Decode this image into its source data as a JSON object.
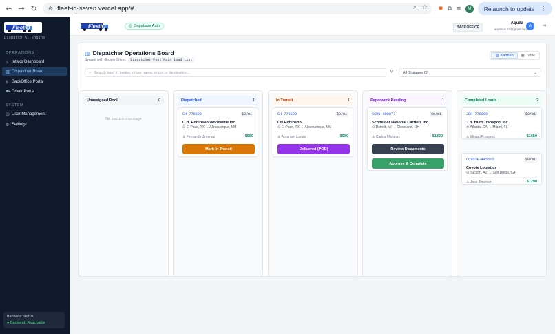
{
  "browser": {
    "url": "fleet-iq-seven.vercel.app/#",
    "relaunch_label": "Relaunch to update",
    "profile_initial": "M"
  },
  "sidebar": {
    "logo_text": "FleetIQ",
    "tagline": "Dispatch AI Engine",
    "operations_label": "OPERATIONS",
    "system_label": "SYSTEM",
    "operations": [
      {
        "label": "Intake Dashboard",
        "icon": "upload-icon"
      },
      {
        "label": "Dispatcher Board",
        "icon": "board-icon"
      },
      {
        "label": "BackOffice Portal",
        "icon": "dollar-icon"
      },
      {
        "label": "Driver Portal",
        "icon": "truck-icon"
      }
    ],
    "system": [
      {
        "label": "User Management",
        "icon": "users-icon"
      },
      {
        "label": "Settings",
        "icon": "gear-icon"
      }
    ],
    "backend_title": "Backend Status",
    "backend_status": "Backend: Reachable"
  },
  "header": {
    "auth_badge": "Supabase Auth",
    "role": "BACKOFFICE",
    "user_name": "Aquila",
    "user_email": "aquila.ai.24@gmail.com",
    "avatar_initial": "A"
  },
  "board": {
    "title": "Dispatcher Operations Board",
    "subtitle_prefix": "Synced with Google Sheet:",
    "sheet_name": "Dispatcher Pool Main Load List",
    "view_kanban": "Kanban",
    "view_table": "Table",
    "search_placeholder": "Search load #, broker, driver name, origin or destination...",
    "status_filter": "All Statuses (5)",
    "columns": [
      {
        "title": "Unassigned Pool",
        "count": "0",
        "empty_text": "No loads in this stage",
        "color": "#f3f4f6",
        "text_color": "#111827"
      },
      {
        "title": "Dispatched",
        "count": "1",
        "color": "#eff6ff",
        "text_color": "#1d4ed8"
      },
      {
        "title": "In Transit",
        "count": "1",
        "color": "#fff7ed",
        "text_color": "#c2410c"
      },
      {
        "title": "Paperwork Pending",
        "count": "1",
        "color": "#faf5ff",
        "text_color": "#7e22ce"
      },
      {
        "title": "Completed Loads",
        "count": "2",
        "color": "#ecfdf5",
        "text_color": "#047857"
      }
    ],
    "cards": [
      {
        "id": "CH-778899",
        "rate": "$0/mi",
        "broker": "C.H. Robinson Worldwide Inc",
        "route": "El Paso, TX → Albuquerque, NM",
        "driver": "Fernando Jimenez",
        "pay": "$980",
        "button": "Mark In Transit"
      },
      {
        "id": "CH-778899",
        "rate": "$0/mi",
        "broker": "CH Robinson",
        "route": "El Paso, TX → Albuquerque, NM",
        "driver": "Abraham Larios",
        "pay": "$980",
        "button": "Delivered (POD)"
      },
      {
        "id": "SCHN-998877",
        "rate": "$0/mi",
        "broker": "Schneider National Carriers Inc",
        "route": "Detroit, MI → Cleveland, OH",
        "driver": "Carlos Martinez",
        "pay": "$1320",
        "button": "Review Documents",
        "button2": "Approve & Complete"
      },
      {
        "id": "JBH-778899",
        "rate": "$0/mi",
        "broker": "J.B. Hunt Transport Inc",
        "route": "Atlanta, GA → Miami, FL",
        "driver": "Miguel Prospect",
        "pay": "$1650"
      },
      {
        "id": "COYOTE-445512",
        "rate": "$0/mi",
        "broker": "Coyote Logistics",
        "route": "Tucson, AZ → San Diego, CA",
        "driver": "Jose Jimenez",
        "pay": "$1290"
      }
    ]
  }
}
